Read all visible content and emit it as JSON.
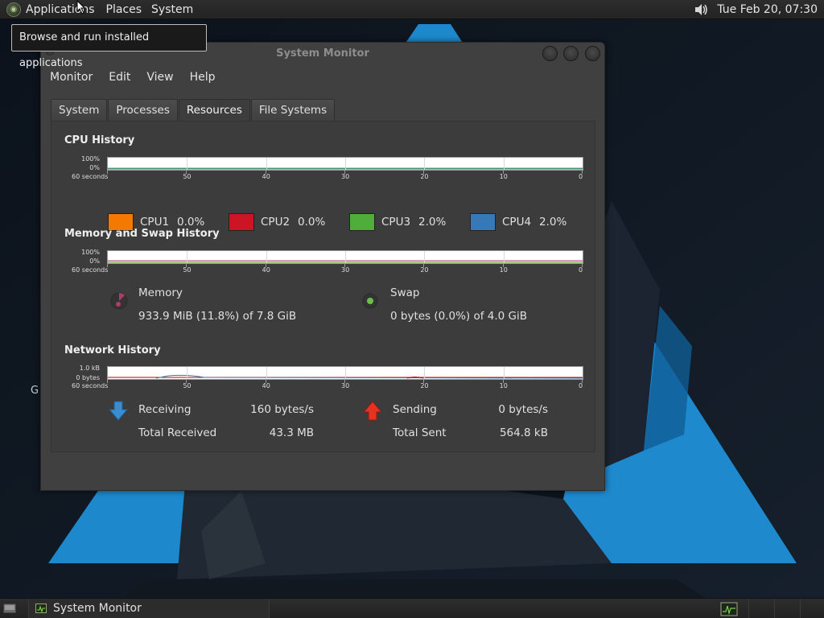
{
  "top_panel": {
    "applications_label": "Applications",
    "places_label": "Places",
    "system_label": "System",
    "clock": "Tue Feb 20, 07:30"
  },
  "tooltip": {
    "text": "Browse and run installed applications"
  },
  "desktop": {
    "partial_icon_label": "G"
  },
  "window": {
    "title": "System Monitor",
    "menu": [
      "Monitor",
      "Edit",
      "View",
      "Help"
    ],
    "tabs": [
      "System",
      "Processes",
      "Resources",
      "File Systems"
    ],
    "active_tab": "Resources"
  },
  "cpu": {
    "title": "CPU History",
    "y_top": "100%",
    "y_bottom": "0%",
    "x_labels": [
      "60 seconds",
      "50",
      "40",
      "30",
      "20",
      "10",
      "0"
    ],
    "items": [
      {
        "name": "CPU1",
        "value": "0.0%",
        "color": "#f57900"
      },
      {
        "name": "CPU2",
        "value": "0.0%",
        "color": "#cc1424"
      },
      {
        "name": "CPU3",
        "value": "2.0%",
        "color": "#4fae3a"
      },
      {
        "name": "CPU4",
        "value": "2.0%",
        "color": "#3579b8"
      }
    ]
  },
  "memory": {
    "title": "Memory and Swap History",
    "y_top": "100%",
    "y_bottom": "0%",
    "x_labels": [
      "60 seconds",
      "50",
      "40",
      "30",
      "20",
      "10",
      "0"
    ],
    "memory_label": "Memory",
    "memory_value": "933.9 MiB (11.8%) of 7.8 GiB",
    "memory_color": "#ad3b6d",
    "swap_label": "Swap",
    "swap_value": "0 bytes (0.0%) of 4.0 GiB",
    "swap_color": "#4e9a06"
  },
  "network": {
    "title": "Network History",
    "y_top": "1.0 kB",
    "y_bottom": "0 bytes",
    "x_labels": [
      "60 seconds",
      "50",
      "40",
      "30",
      "20",
      "10",
      "0"
    ],
    "receiving_label": "Receiving",
    "receiving_value": "160 bytes/s",
    "total_received_label": "Total Received",
    "total_received_value": "43.3 MB",
    "sending_label": "Sending",
    "sending_value": "0 bytes/s",
    "total_sent_label": "Total Sent",
    "total_sent_value": "564.8 kB",
    "receiving_color": "#2d7db3",
    "sending_color": "#c00000"
  },
  "bottom_panel": {
    "task_label": "System Monitor"
  }
}
